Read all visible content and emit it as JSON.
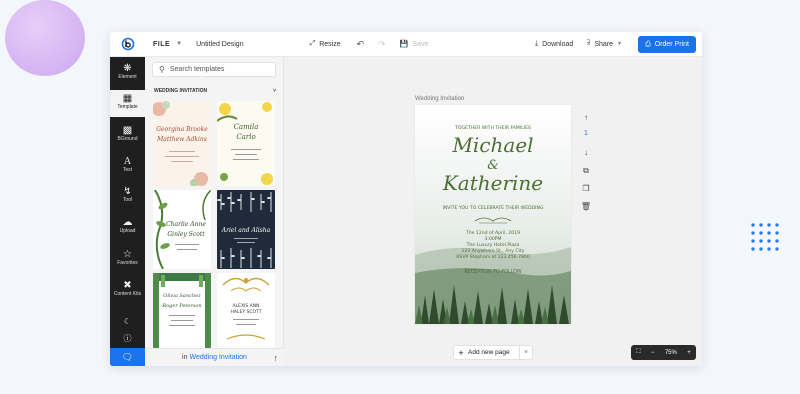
{
  "topbar": {
    "file_label": "FILE",
    "design_title": "Untitled Design",
    "resize_label": "Resize",
    "save_label": "Save",
    "download_label": "Download",
    "share_label": "Share",
    "order_print_label": "Order Print"
  },
  "rail": {
    "items": [
      {
        "label": "Element",
        "icon": "shapes-icon"
      },
      {
        "label": "Template",
        "icon": "template-icon"
      },
      {
        "label": "BGround",
        "icon": "background-icon"
      },
      {
        "label": "Text",
        "icon": "text-icon"
      },
      {
        "label": "Tool",
        "icon": "tool-icon"
      },
      {
        "label": "Upload",
        "icon": "cloud-upload-icon"
      },
      {
        "label": "Favorites",
        "icon": "star-icon"
      },
      {
        "label": "Content Kits",
        "icon": "tools-icon"
      }
    ]
  },
  "panel": {
    "search_placeholder": "Search templates",
    "section_title": "WEDDING INVITATION",
    "footer_prefix": "in",
    "footer_link": "Wedding Invitation",
    "thumbs": [
      {
        "script": "Georgina Brooke",
        "script2": "Matthew Adkins"
      },
      {
        "script": "Camila",
        "script2": "Carlo"
      },
      {
        "script": "Charlie Anne",
        "script2": "Ginley Scott"
      },
      {
        "script": "Ariel and Alisha",
        "script2": ""
      },
      {
        "script": "Olivia Sanchez",
        "script2": "Roger Peterson"
      },
      {
        "script": "ALEXIS ANN",
        "script2": "HALEY SCOTT"
      }
    ]
  },
  "canvas": {
    "page_label": "Wedding Invitation",
    "page_number": "1",
    "add_page_label": "Add new page",
    "zoom_level": "75%"
  },
  "invitation": {
    "header": "TOGETHER WITH THEIR FAMILIES",
    "name1": "Michael",
    "amp": "&",
    "name2": "Katherine",
    "invite_line": "INVITE YOU TO CELEBRATE THEIR WEDDING",
    "date": "The 12nd of April, 2019",
    "time": "3:00PM",
    "venue": "The Luxury Hotel Plaza",
    "address": "123 Anywhere St., Any City",
    "rsvp": "RSVP Stephani at 123.456.7800",
    "reception": "RECEPTION TO FOLLOW"
  },
  "colors": {
    "accent": "#1a73e8",
    "green_text": "#4e6e35",
    "rail_bg": "#1f1f1f"
  }
}
